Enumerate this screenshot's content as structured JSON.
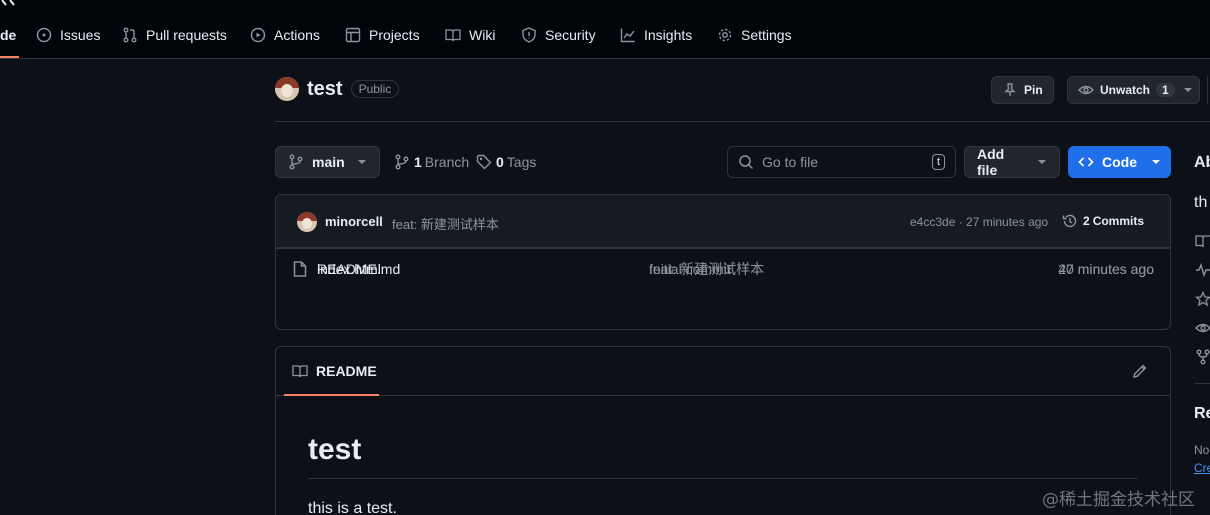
{
  "nav": {
    "active_fragment": "de",
    "tabs": [
      {
        "label": "Issues",
        "icon": "issue-icon"
      },
      {
        "label": "Pull requests",
        "icon": "pull-request-icon"
      },
      {
        "label": "Actions",
        "icon": "play-icon"
      },
      {
        "label": "Projects",
        "icon": "table-icon"
      },
      {
        "label": "Wiki",
        "icon": "book-icon"
      },
      {
        "label": "Security",
        "icon": "shield-icon"
      },
      {
        "label": "Insights",
        "icon": "graph-icon"
      },
      {
        "label": "Settings",
        "icon": "gear-icon"
      }
    ]
  },
  "repo": {
    "name": "test",
    "visibility": "Public",
    "pin_label": "Pin",
    "unwatch_label": "Unwatch",
    "watch_count": "1"
  },
  "toolbar": {
    "branch": "main",
    "branch_count": "1",
    "branch_label": "Branch",
    "tag_count": "0",
    "tag_label": "Tags",
    "search_placeholder": "Go to file",
    "search_shortcut": "t",
    "add_file_label": "Add file",
    "code_label": "Code"
  },
  "latest_commit": {
    "author": "minorcell",
    "message": "feat: 新建测试样本",
    "hash_time": "e4cc3de · 27 minutes ago",
    "commits_count": "2",
    "commits_label": "Commits"
  },
  "files": [
    {
      "name": "README.md",
      "message": "Initial commit",
      "time": "40 minutes ago"
    },
    {
      "name": "index.html",
      "message": "feat: 新建测试样本",
      "time": "27 minutes ago"
    }
  ],
  "readme": {
    "tab_label": "README",
    "heading": "test",
    "body": "this is a test."
  },
  "sidebar": {
    "about_fragment": "Ab",
    "desc_fragment": "th",
    "releases_fragment": "Re",
    "no_fragment": "No",
    "create_fragment": "Cre"
  },
  "watermark": "@稀土掘金技术社区"
}
